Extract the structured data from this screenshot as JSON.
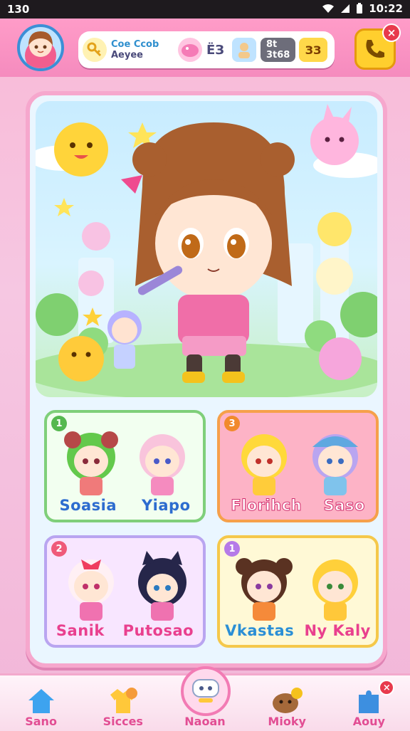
{
  "status_bar": {
    "left_time": "130",
    "right_time": "10:22"
  },
  "top_bar": {
    "profile_line1": "Coe Ccob",
    "profile_line2": "Aeyee",
    "gem_text": "ЁЗ",
    "stat_line1": "8t",
    "stat_line2": "3t68",
    "coin_text": "ЗЗ"
  },
  "cards": [
    {
      "num": "1",
      "name_a": "Soasia",
      "name_b": "Yiapo"
    },
    {
      "num": "3",
      "name_a": "Florihch",
      "name_b": "Saso"
    },
    {
      "num": "2",
      "name_a": "Sanik",
      "name_b": "Putosao"
    },
    {
      "num": "1",
      "name_a": "Vkastas",
      "name_b": "Ny Kaly"
    }
  ],
  "nav": {
    "item1": "Sano",
    "item2": "Sicces",
    "item3": "Naoan",
    "item4": "Mioky",
    "item5": "Aouy"
  },
  "colors": {
    "accent_pink": "#f27bb4",
    "card1_border": "#7fcf7a",
    "card2_border": "#f6a04a",
    "card3_border": "#b9a5f0",
    "card4_border": "#f5c84a"
  }
}
